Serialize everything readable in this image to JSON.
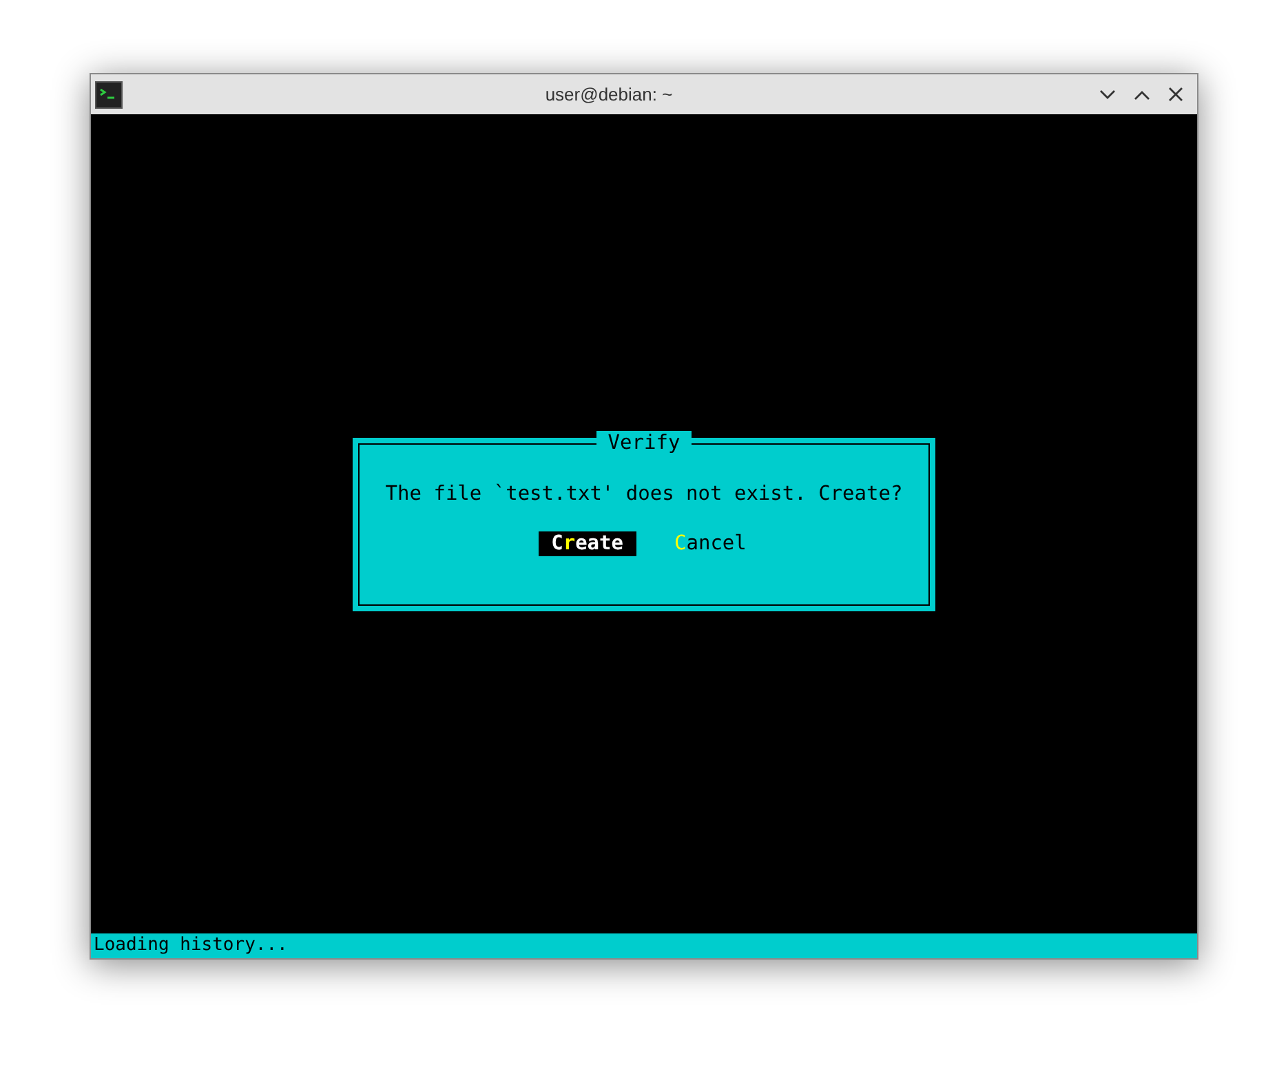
{
  "window": {
    "title": "user@debian: ~"
  },
  "dialog": {
    "title": "Verify",
    "message": "The file `test.txt' does not exist. Create?",
    "buttons": [
      {
        "before": "C",
        "hotkey": "r",
        "after": "eate",
        "selected": true
      },
      {
        "hotkey": "C",
        "after": "ancel",
        "selected": false
      }
    ]
  },
  "status_bar": "Loading history..."
}
